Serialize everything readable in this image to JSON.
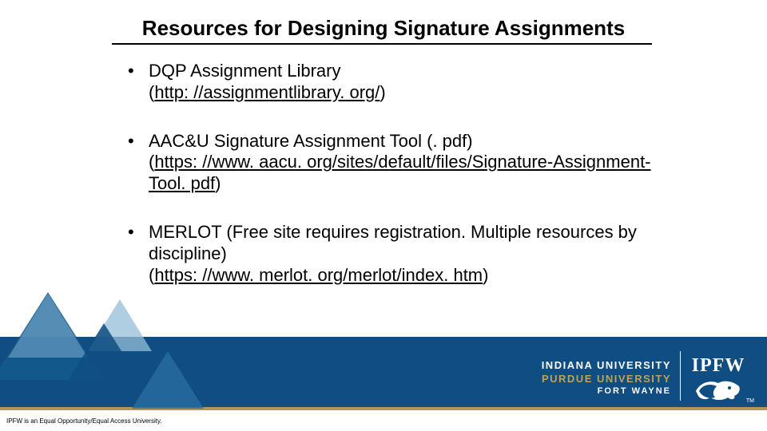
{
  "title": "Resources for Designing Signature Assignments",
  "bullets": [
    {
      "text": "DQP Assignment Library",
      "link_open": "(",
      "link_label": "http: //assignmentlibrary. org/",
      "link_close": ")"
    },
    {
      "text": "AAC&U Signature Assignment Tool (. pdf)",
      "link_open": "(",
      "link_label": "https: //www. aacu. org/sites/default/files/Signature-Assignment-Tool. pdf",
      "link_close": ")"
    },
    {
      "text": "MERLOT (Free site requires registration.  Multiple resources by discipline)",
      "link_open": "(",
      "link_label": "https: //www. merlot. org/merlot/index. htm",
      "link_close": ")"
    }
  ],
  "brand": {
    "line1": "INDIANA UNIVERSITY",
    "line2": "PURDUE UNIVERSITY",
    "line3": "FORT WAYNE",
    "logo_text": "IPFW",
    "tm": "TM"
  },
  "disclaimer": "IPFW is an Equal Opportunity/Equal Access University.",
  "colors": {
    "band": "#0f4d82",
    "gold": "#c0a24f"
  }
}
